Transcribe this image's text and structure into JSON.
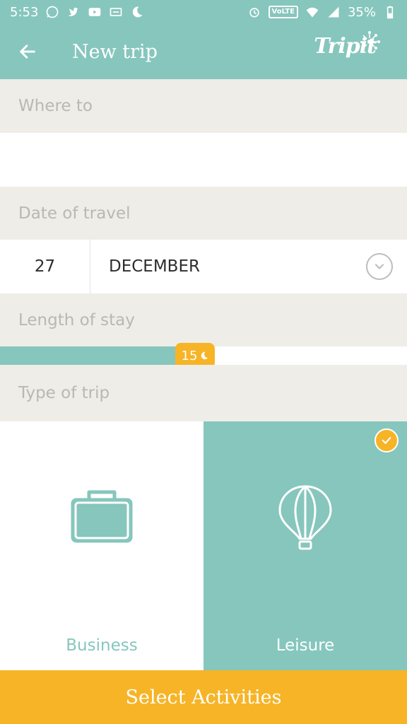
{
  "status_bar": {
    "time": "5:53",
    "network_badge": "VoLTE",
    "battery": "35%"
  },
  "app_bar": {
    "title": "New trip",
    "logo_text": "Tripit"
  },
  "sections": {
    "where_to": "Where to",
    "date_of_travel": "Date of travel",
    "length_of_stay": "Length of stay",
    "type_of_trip": "Type of trip"
  },
  "date": {
    "day": "27",
    "month": "DECEMBER"
  },
  "stay": {
    "nights": "15",
    "fill_fraction": 0.48
  },
  "trip_types": [
    {
      "label": "Business",
      "selected": false,
      "icon": "briefcase-icon"
    },
    {
      "label": "Leisure",
      "selected": true,
      "icon": "hot-air-balloon-icon"
    }
  ],
  "cta": {
    "label": "Select Activities"
  },
  "colors": {
    "teal": "#86c6bd",
    "accent": "#f6b426",
    "section_bg": "#eeede8"
  }
}
